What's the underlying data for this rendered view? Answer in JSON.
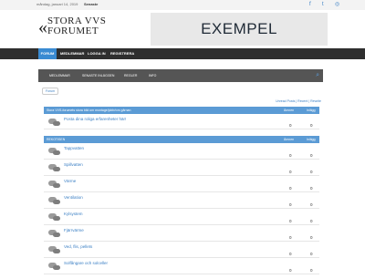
{
  "topbar": {
    "date": "måndag, januari 14, 2019",
    "news_label": "Senaste"
  },
  "logo": {
    "line1": "STORA VVS",
    "line2": "FORUMET"
  },
  "banner": {
    "text": "EXEMPEL"
  },
  "nav": {
    "items": [
      "FORUM",
      "MEDLEMMAR",
      "LOGGA IN",
      "REGISTRERA"
    ]
  },
  "subnav": {
    "items": [
      "MEDLEMMAR",
      "SENASTE INLÄGGEN",
      "REGLER",
      "INFO"
    ]
  },
  "breadcrumb": "Forum",
  "toplinks": "Unread Posts | Recent | Rewrite",
  "section1": {
    "title": "Stora VVS-forumets stora bild om montage/jobb/vvs gärnan",
    "col1": "Ämnen",
    "col2": "Inlägg",
    "rows": [
      {
        "title": "Posta dina roliga erfarenheter här!",
        "topics": "0",
        "posts": "0"
      }
    ]
  },
  "section2": {
    "title": "REKOTISEN",
    "col1": "Ämnen",
    "col2": "Inlägg",
    "rows": [
      {
        "title": "Tappvatten",
        "topics": "0",
        "posts": "0"
      },
      {
        "title": "Spillvatten",
        "topics": "0",
        "posts": "0"
      },
      {
        "title": "Värme",
        "topics": "0",
        "posts": "0"
      },
      {
        "title": "Ventilation",
        "topics": "0",
        "posts": "0"
      },
      {
        "title": "Kylsystem",
        "topics": "0",
        "posts": "0"
      },
      {
        "title": "Fjärrvärme",
        "topics": "0",
        "posts": "0"
      },
      {
        "title": "Ved, flis, pellets",
        "topics": "0",
        "posts": "0"
      },
      {
        "title": "Solfångare och solceller",
        "topics": "0",
        "posts": "0"
      }
    ]
  },
  "colors": {
    "accent": "#3a8bd2",
    "section": "#5b9bd5",
    "nav": "#2f2f2f",
    "subnav": "#555555"
  },
  "icons": [
    "facebook-icon",
    "twitter-icon",
    "instagram-icon",
    "search-icon",
    "forum-bubble-icon"
  ]
}
